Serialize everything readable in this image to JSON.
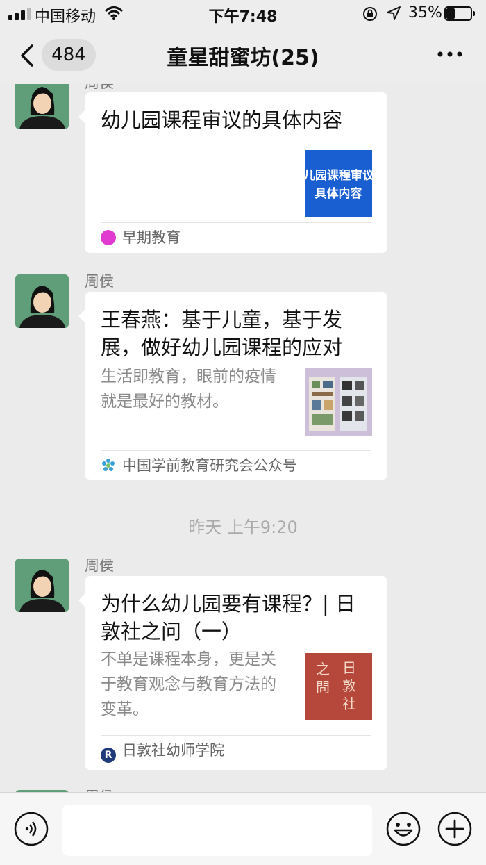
{
  "status_bar": {
    "carrier": "中国移动",
    "time": "下午7:48",
    "battery": "35%",
    "battery_level": 0.35
  },
  "nav": {
    "unread_count": "484",
    "title": "童星甜蜜坊(25)"
  },
  "messages": [
    {
      "sender": "周侯",
      "title": "幼儿园课程审议的具体内容",
      "thumb_text": [
        "儿园课程审议",
        "具体内容"
      ],
      "source": "早期教育"
    },
    {
      "sender": "周侯",
      "title": "王春燕：基于儿童，基于发展，做好幼儿园课程的应对",
      "desc": "生活即教育，眼前的疫情就是最好的教材。",
      "source": "中国学前教育研究会公众号"
    },
    {
      "sender": "周侯",
      "title": "为什么幼儿园要有课程？| 日敦社之问（一）",
      "desc": "不单是课程本身，更是关于教育观念与教育方法的变革。",
      "thumb_text": [
        "之",
        "問",
        "日",
        "敦",
        "社"
      ],
      "source": "日敦社幼师学院"
    },
    {
      "sender": "周侯"
    }
  ],
  "timestamp": "昨天 上午9:20",
  "colors": {
    "avatar_bg": "#5f9e78",
    "link_thumb_blue": "#1a5fd1",
    "thumb_red": "#b5473b",
    "source_icon_pink": "#e03ad0",
    "source_icon_navy": "#1f3a7a"
  }
}
